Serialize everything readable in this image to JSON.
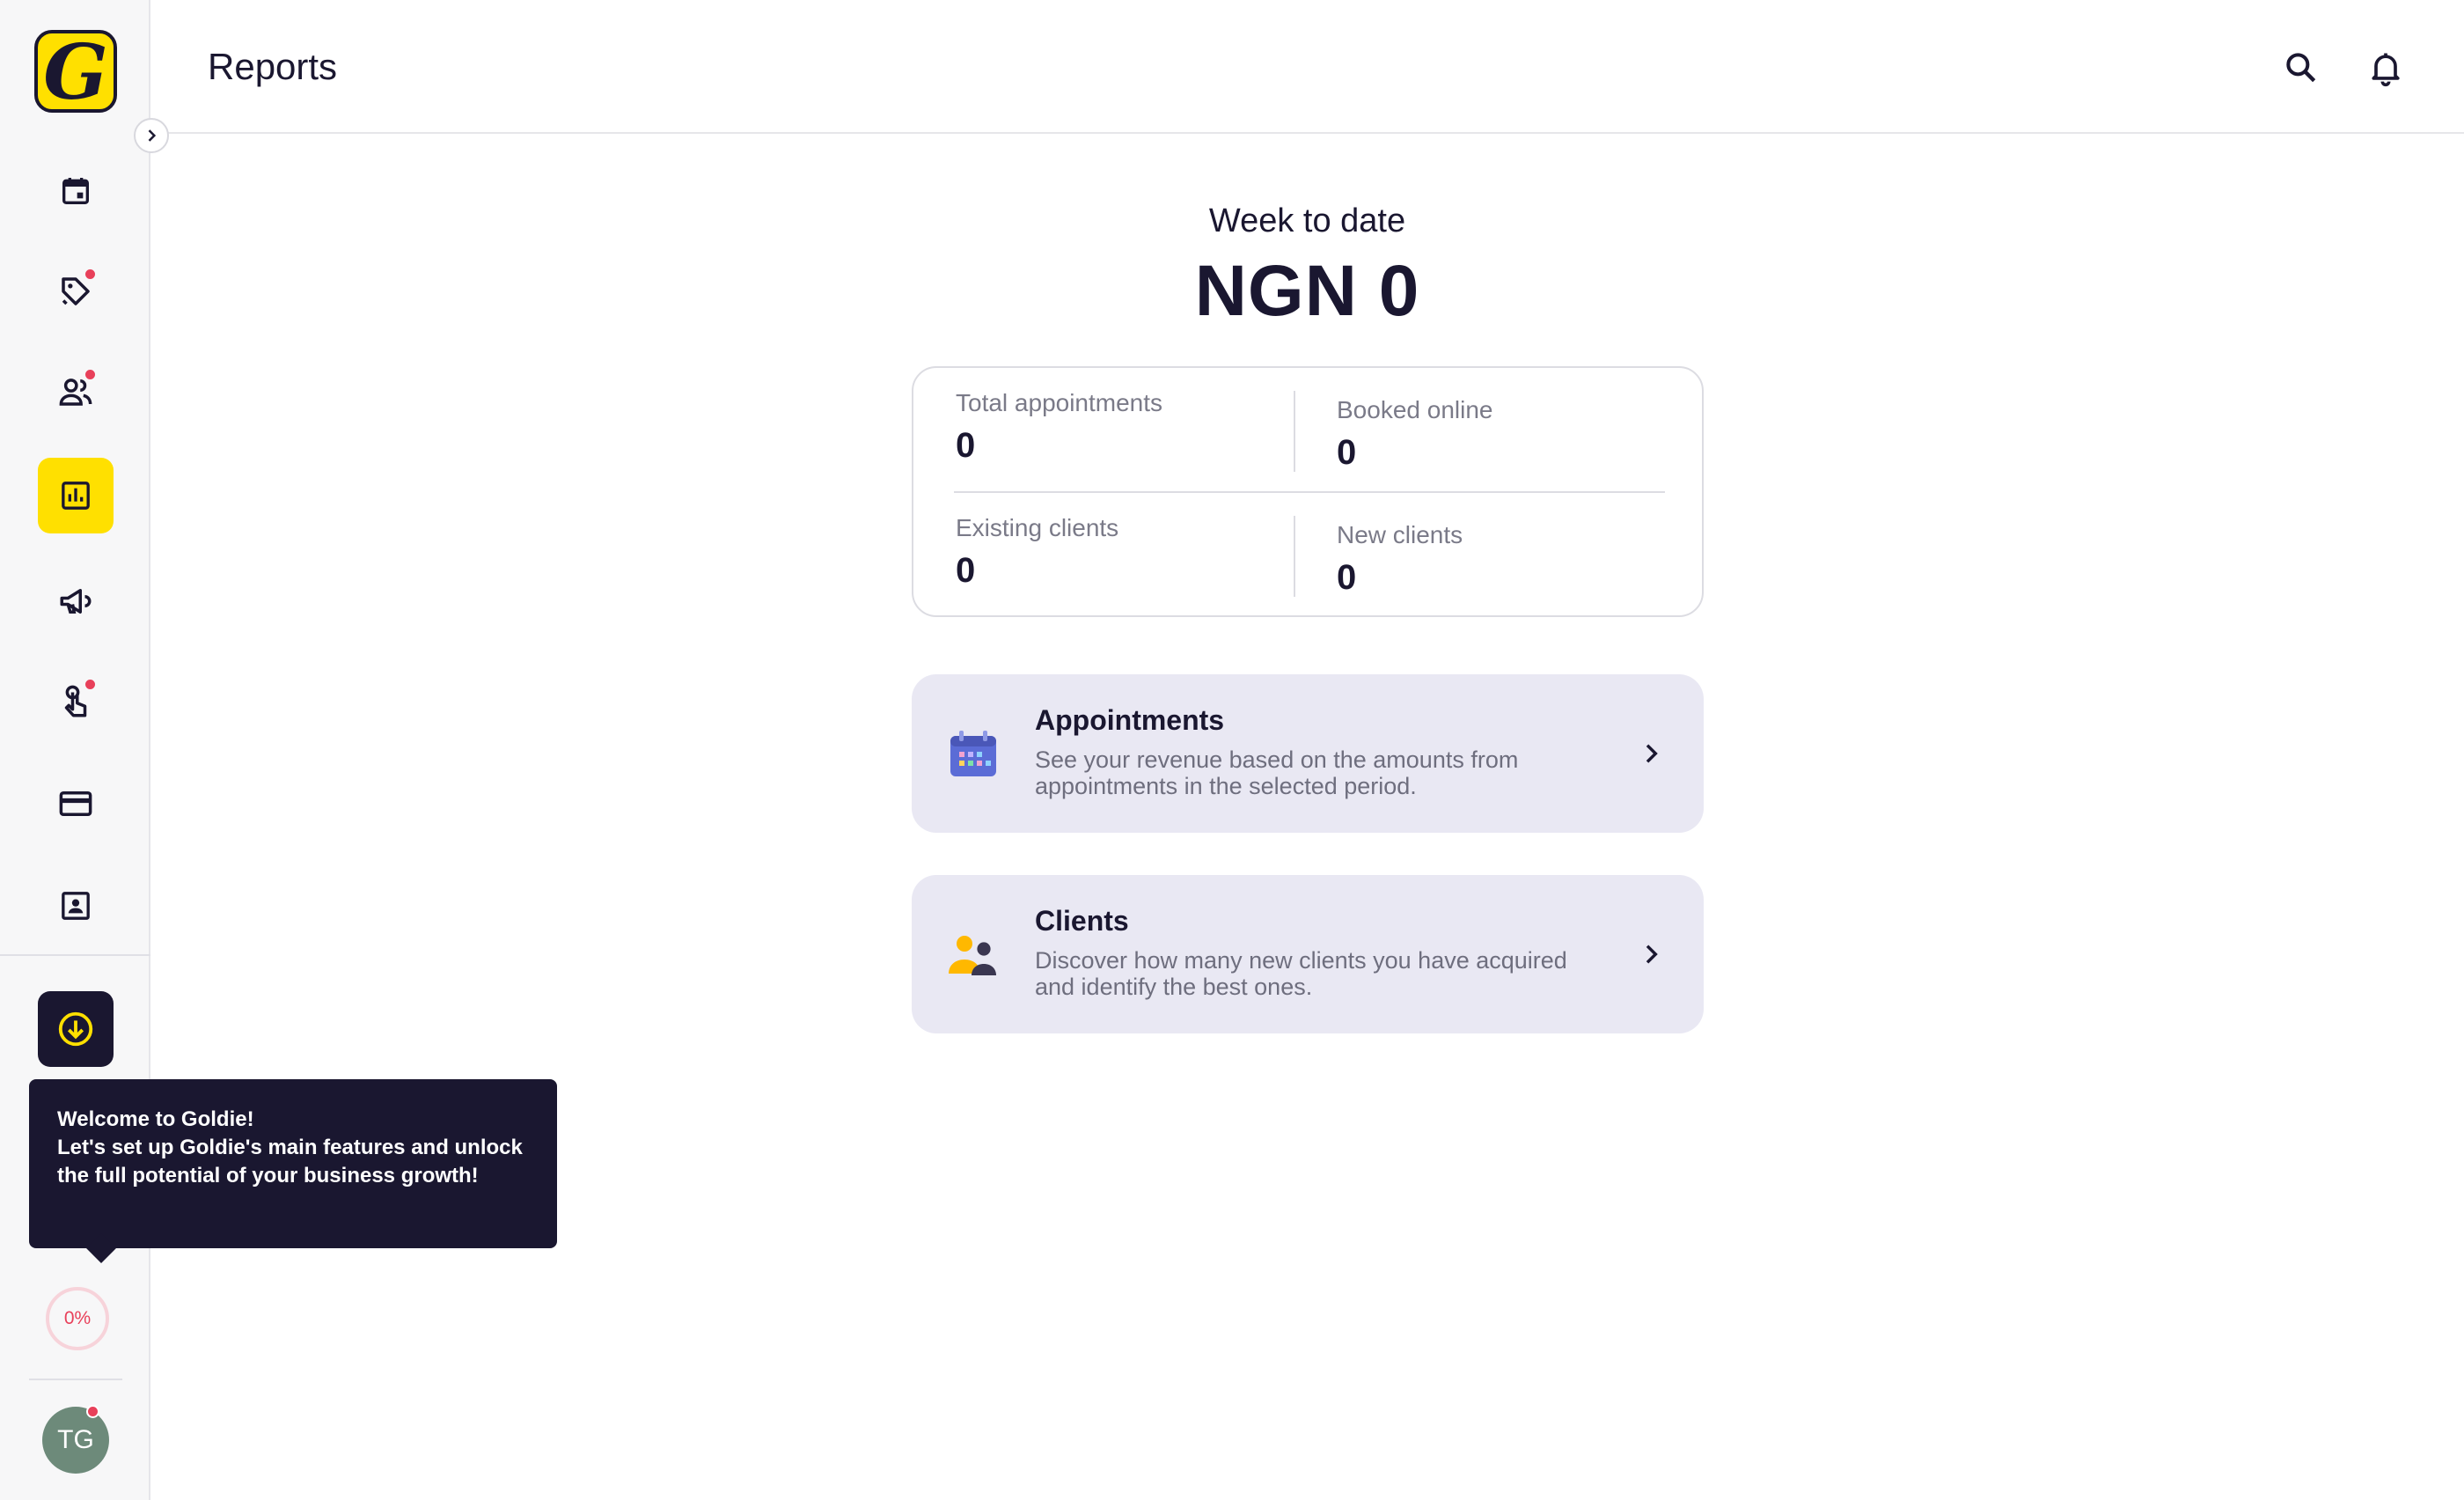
{
  "app": {
    "logo_letter": "G",
    "brand_color": "#ffe000",
    "dark_color": "#1a1730",
    "alert_color": "#e8405a"
  },
  "header": {
    "title": "Reports",
    "icons": [
      "search-icon",
      "bell-icon"
    ]
  },
  "sidebar": {
    "items": [
      {
        "name": "calendar",
        "icon": "calendar-icon",
        "active": false,
        "badge": false
      },
      {
        "name": "services",
        "icon": "tag-icon",
        "active": false,
        "badge": true
      },
      {
        "name": "clients",
        "icon": "users-icon",
        "active": false,
        "badge": true
      },
      {
        "name": "reports",
        "icon": "bar-chart-icon",
        "active": true,
        "badge": false
      },
      {
        "name": "marketing",
        "icon": "megaphone-icon",
        "active": false,
        "badge": false
      },
      {
        "name": "online-booking",
        "icon": "hand-tap-icon",
        "active": false,
        "badge": true
      },
      {
        "name": "payments",
        "icon": "credit-card-icon",
        "active": false,
        "badge": false
      },
      {
        "name": "profile",
        "icon": "contact-card-icon",
        "active": false,
        "badge": false
      }
    ],
    "setup_progress": "0%",
    "avatar_initials": "TG"
  },
  "tooltip": {
    "title": "Welcome to Goldie!",
    "body": "Let's set up Goldie's main features and unlock the full potential of your business growth!"
  },
  "summary": {
    "period_label": "Week to date",
    "amount": "NGN 0"
  },
  "stats": {
    "total_appointments": {
      "label": "Total appointments",
      "value": "0"
    },
    "booked_online": {
      "label": "Booked online",
      "value": "0"
    },
    "existing_clients": {
      "label": "Existing clients",
      "value": "0"
    },
    "new_clients": {
      "label": "New clients",
      "value": "0"
    }
  },
  "reports": [
    {
      "title": "Appointments",
      "description": "See your revenue based on the amounts from appointments in the selected period.",
      "icon": "calendar-color-icon"
    },
    {
      "title": "Clients",
      "description": "Discover how many new clients you have acquired and identify the best ones.",
      "icon": "clients-color-icon"
    }
  ]
}
